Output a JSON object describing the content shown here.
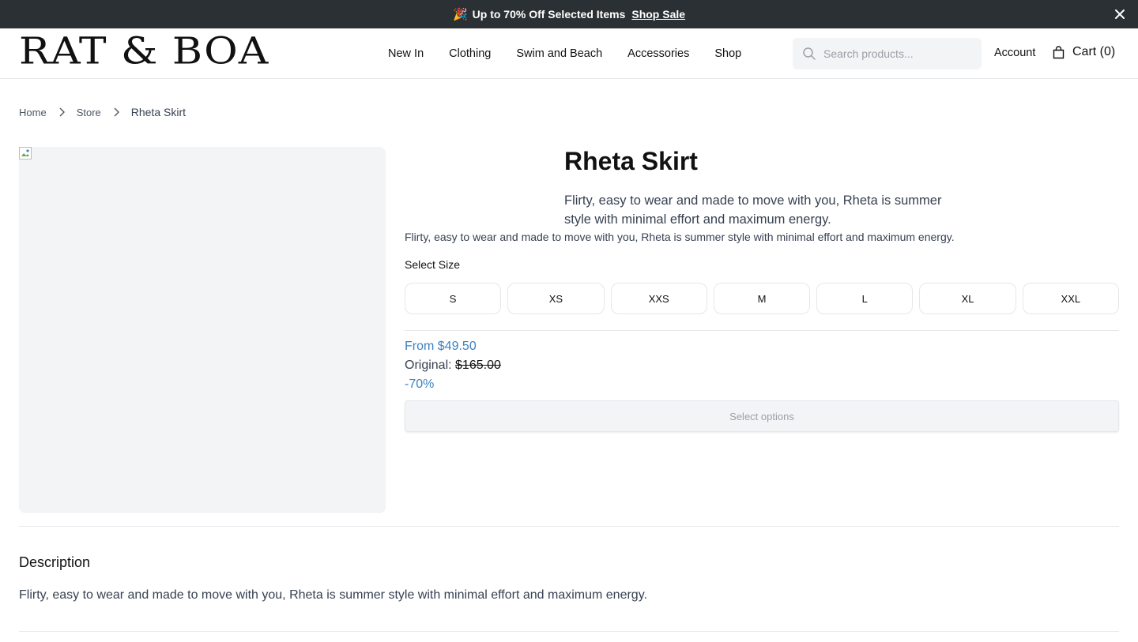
{
  "promo": {
    "emoji": "🎉",
    "text": "Up to 70% Off Selected Items",
    "link_label": "Shop Sale",
    "close_icon": "close-icon"
  },
  "header": {
    "logo": "RAT & BOA",
    "nav": [
      "New In",
      "Clothing",
      "Swim and Beach",
      "Accessories",
      "Shop"
    ],
    "search_placeholder": "Search products...",
    "search_value": "",
    "account_label": "Account",
    "cart_label": "Cart (0)"
  },
  "breadcrumb": {
    "items": [
      "Home",
      "Store"
    ],
    "current": "Rheta Skirt"
  },
  "product": {
    "title": "Rheta Skirt",
    "short_description": "Flirty, easy to wear and made to move with you, Rheta is summer style with minimal effort and maximum energy.",
    "long_description": "Flirty, easy to wear and made to move with you, Rheta is summer style with minimal effort and maximum energy.",
    "size_label": "Select Size",
    "sizes": [
      "S",
      "XS",
      "XXS",
      "M",
      "L",
      "XL",
      "XXL"
    ],
    "price_from": "From $49.50",
    "original_label": "Original:",
    "original_price": "$165.00",
    "discount": "-70%",
    "select_button": "Select options"
  },
  "description": {
    "heading": "Description",
    "body": "Flirty, easy to wear and made to move with you, Rheta is summer style with minimal effort and maximum energy."
  },
  "colors": {
    "promo_bg": "#2b3034",
    "accent_blue": "#3b82c4",
    "image_placeholder": "#f3f4f6"
  }
}
